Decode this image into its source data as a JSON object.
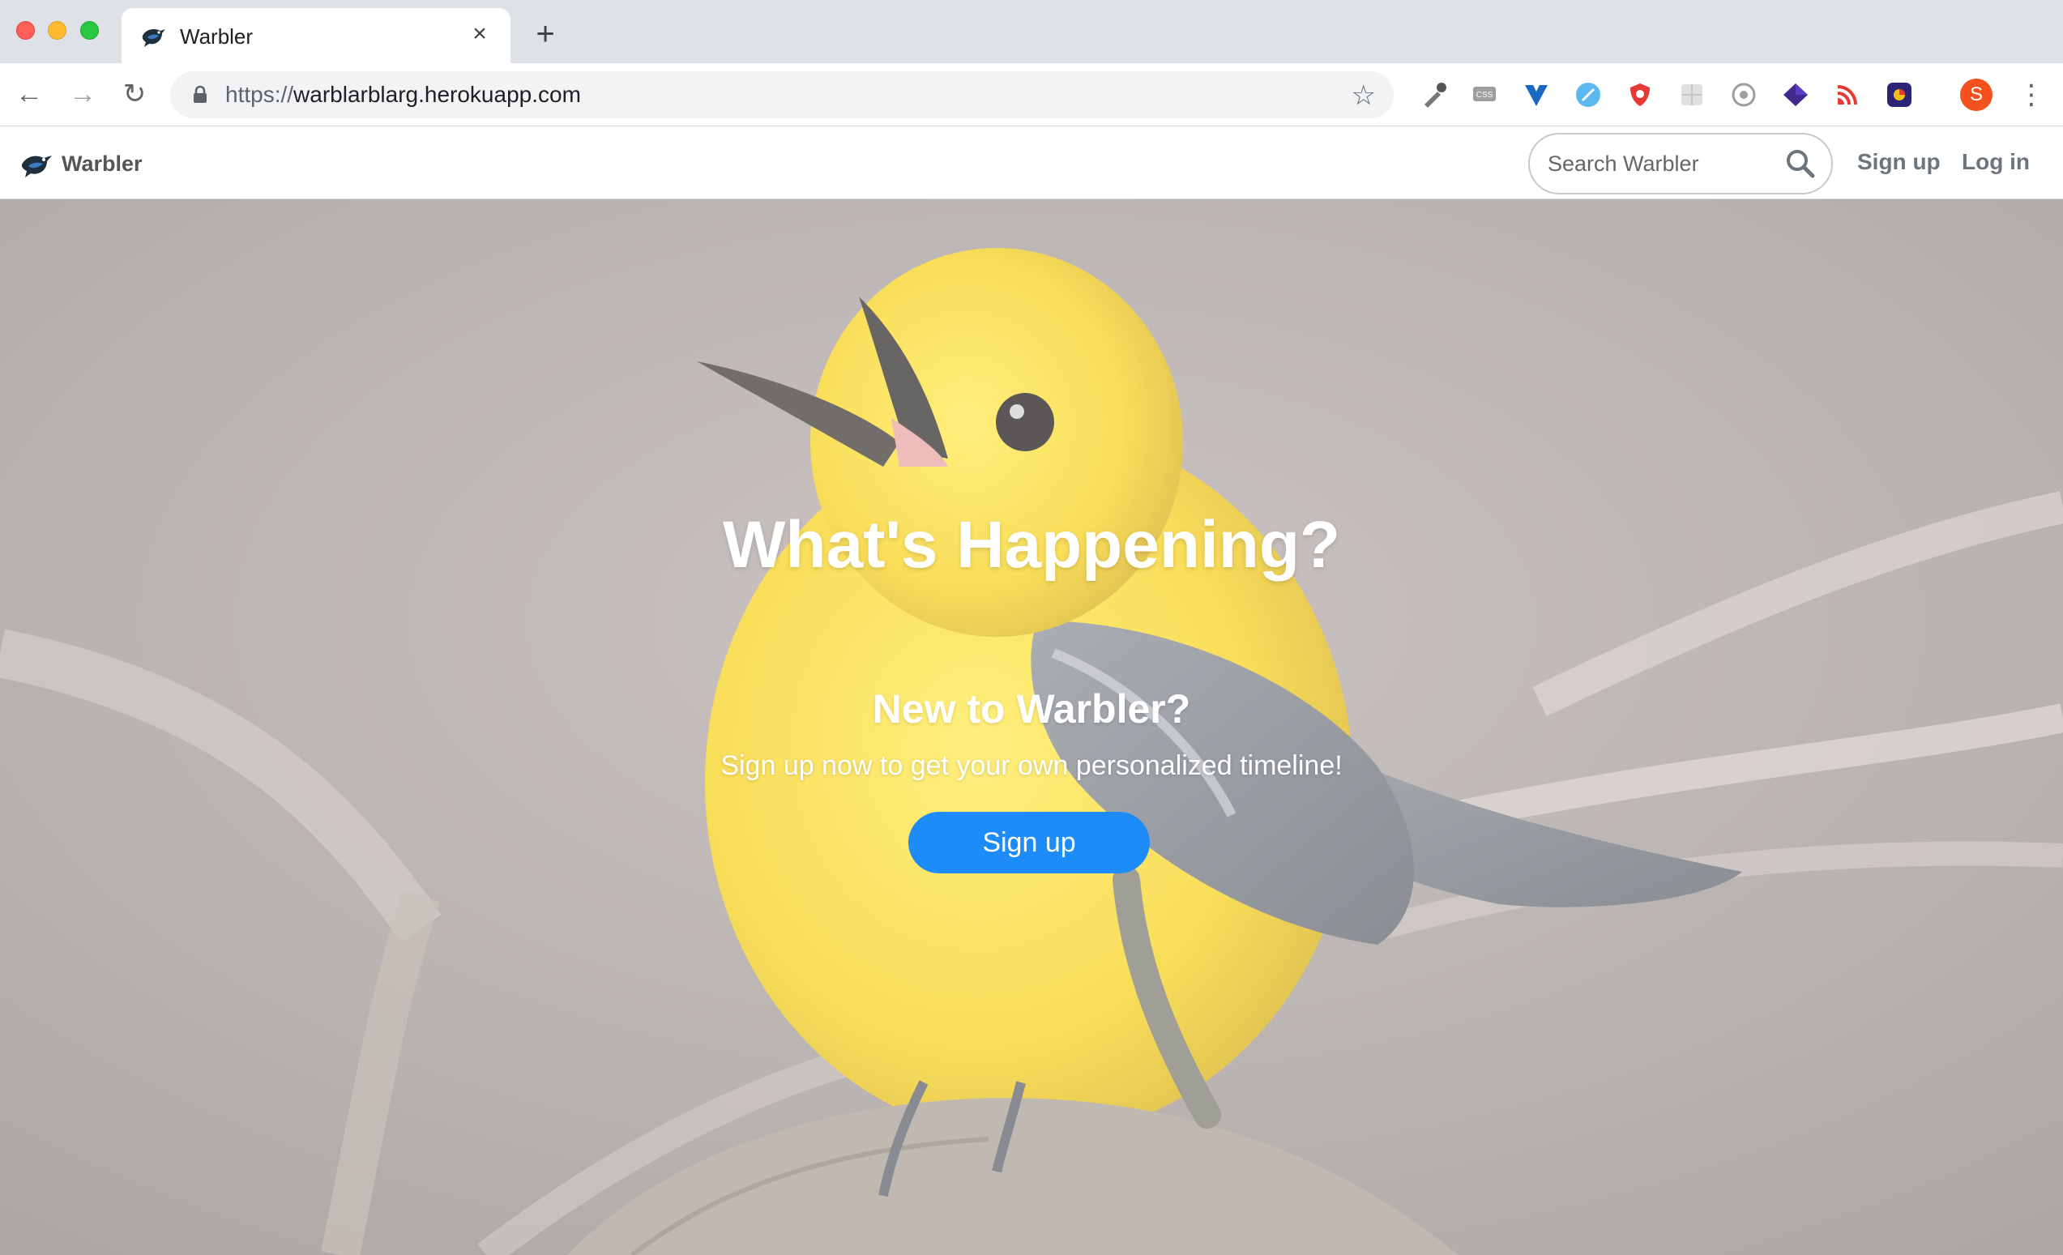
{
  "browser": {
    "tab_title": "Warbler",
    "tab_close": "×",
    "new_tab": "+",
    "url_scheme": "https://",
    "url_host": "warblarblarg.herokuapp.com",
    "profile_initial": "S"
  },
  "navbar": {
    "brand": "Warbler",
    "search_placeholder": "Search Warbler",
    "signup_label": "Sign up",
    "login_label": "Log in"
  },
  "hero": {
    "title": "What's Happening?",
    "subtitle": "New to Warbler?",
    "text": "Sign up now to get your own personalized timeline!",
    "cta_label": "Sign up"
  },
  "colors": {
    "cta": "#1d8cf8",
    "bird_yellow": "#f9d81e",
    "avatar": "#f4511e"
  }
}
